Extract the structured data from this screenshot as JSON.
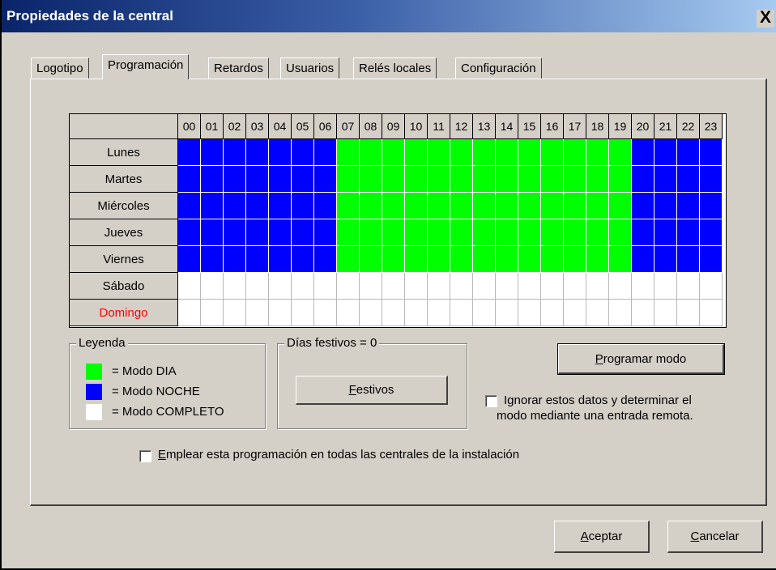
{
  "window": {
    "title": "Propiedades de la central",
    "close_label": "X"
  },
  "tabs": [
    {
      "label": "Logotipo"
    },
    {
      "label": "Programación",
      "active": true
    },
    {
      "label": "Retardos"
    },
    {
      "label": "Usuarios"
    },
    {
      "label": "Relés locales"
    },
    {
      "label": "Configuración"
    }
  ],
  "schedule": {
    "hours": [
      "00",
      "01",
      "02",
      "03",
      "04",
      "05",
      "06",
      "07",
      "08",
      "09",
      "10",
      "11",
      "12",
      "13",
      "14",
      "15",
      "16",
      "17",
      "18",
      "19",
      "20",
      "21",
      "22",
      "23"
    ],
    "days": [
      {
        "label": "Lunes",
        "color": "#000000",
        "modes": "NNNNNNNDDDDDDDDDDDDDNNNN"
      },
      {
        "label": "Martes",
        "color": "#000000",
        "modes": "NNNNNNNDDDDDDDDDDDDDNNNN"
      },
      {
        "label": "Miércoles",
        "color": "#000000",
        "modes": "NNNNNNNDDDDDDDDDDDDDNNNN"
      },
      {
        "label": "Jueves",
        "color": "#000000",
        "modes": "NNNNNNNDDDDDDDDDDDDDNNNN"
      },
      {
        "label": "Viernes",
        "color": "#000000",
        "modes": "NNNNNNNDDDDDDDDDDDDDNNNN"
      },
      {
        "label": "Sábado",
        "color": "#000000",
        "modes": "CCCCCCCCCCCCCCCCCCCCCCCC"
      },
      {
        "label": "Domingo",
        "color": "#ff0000",
        "modes": "CCCCCCCCCCCCCCCCCCCCCCCC"
      }
    ]
  },
  "legend": {
    "title": "Leyenda",
    "items": [
      {
        "label": "= Modo DIA",
        "color": "#00ff00",
        "code": "D"
      },
      {
        "label": "= Modo NOCHE",
        "color": "#0000ff",
        "code": "N"
      },
      {
        "label": "= Modo COMPLETO",
        "color": "#ffffff",
        "code": "C"
      }
    ]
  },
  "holidays": {
    "title": "Días festivos = 0",
    "button_label": "Festivos",
    "button_mnemonic": "F"
  },
  "program_mode_button": {
    "label": "Programar modo",
    "mnemonic": "P"
  },
  "ignore_checkbox": {
    "line1": "Ignorar estos datos y determinar el",
    "line2": "modo mediante una entrada remota.",
    "checked": false
  },
  "apply_all_checkbox": {
    "label": "Emplear esta programación en todas las centrales de la instalación",
    "checked": false
  },
  "footer": {
    "accept_label": "Aceptar",
    "cancel_label": "Cancelar"
  }
}
